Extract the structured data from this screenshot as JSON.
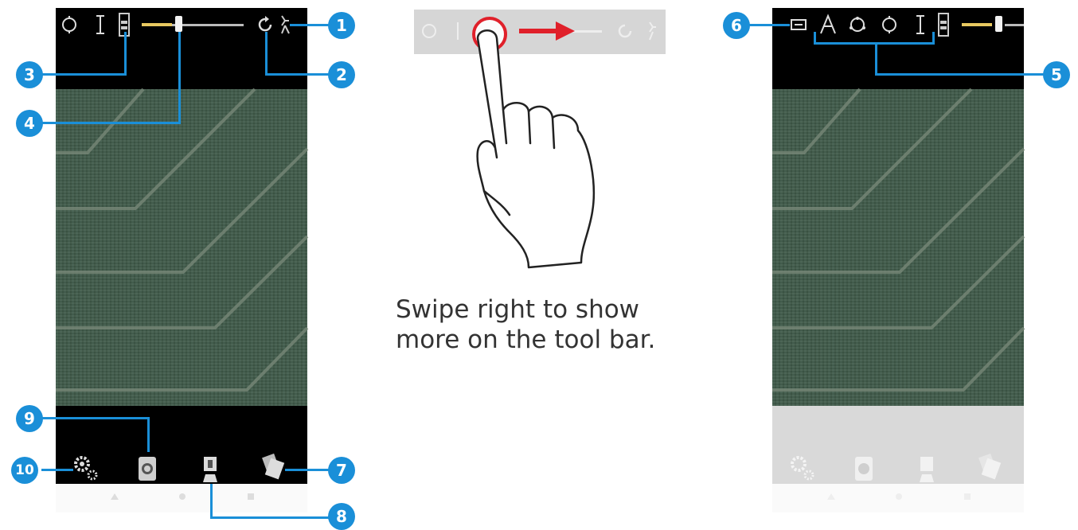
{
  "caption": {
    "line1": "Swipe right to show",
    "line2": "more on the tool bar."
  },
  "colors": {
    "callout": "#1a8fd8",
    "swipe_arrow": "#e0202a",
    "phone_bar": "#000000",
    "pcb": "#3f5a49"
  },
  "callouts": {
    "c1": "1",
    "c2": "2",
    "c3": "3",
    "c4": "4",
    "c5": "5",
    "c6": "6",
    "c7": "7",
    "c8": "8",
    "c9": "9",
    "c10": "10"
  },
  "toolbar_left": {
    "icons": [
      "circle-measure-icon",
      "length-measure-icon",
      "battery-meter-icon",
      "brightness-slider",
      "rotate-icon",
      "walk-mode-icon"
    ],
    "slider_level_fraction": 0.3
  },
  "toolbar_right": {
    "icons": [
      "display-mode-icon",
      "text-annotation-icon",
      "circle-3pt-icon",
      "circle-icon",
      "length-icon",
      "battery-meter-icon",
      "brightness-slider"
    ]
  },
  "bottom_bar": {
    "icons": [
      "settings-gears-icon",
      "capture-camera-icon",
      "record-video-icon",
      "gallery-icon"
    ]
  },
  "android_nav": {
    "icons": [
      "back-icon",
      "home-icon",
      "recents-icon"
    ]
  }
}
